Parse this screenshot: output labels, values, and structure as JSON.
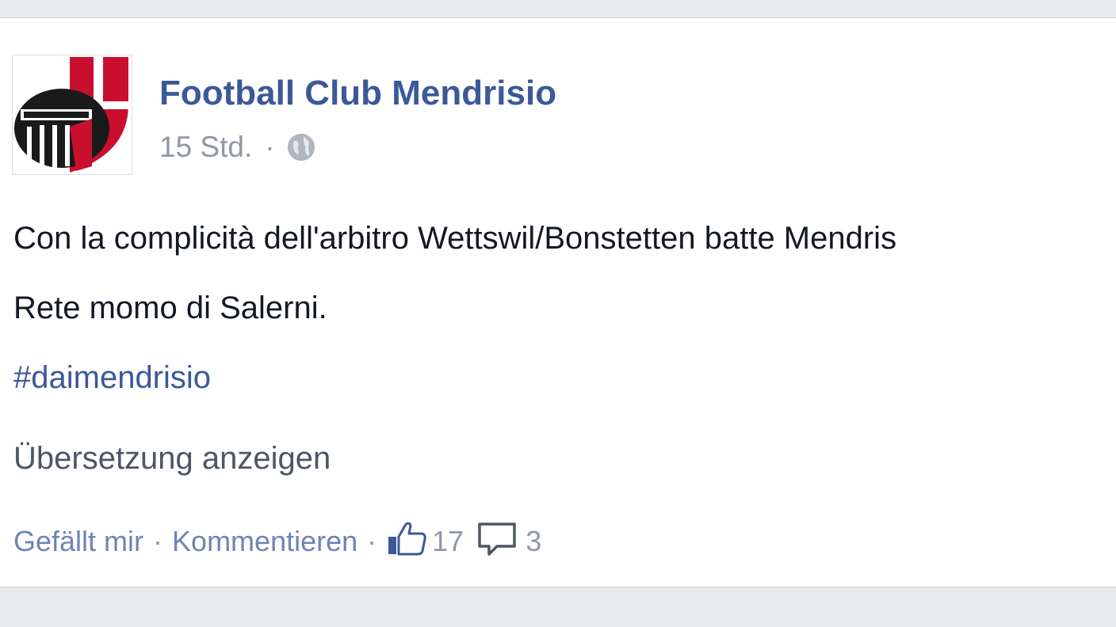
{
  "post": {
    "page_name": "Football Club Mendrisio",
    "time": "15 Std.",
    "meta_separator": "·",
    "audience_icon": "globe-icon",
    "text_line_1": "Con la complicità dell'arbitro Wettswil/Bonstetten batte Mendris",
    "text_line_2": "Rete momo di Salerni.",
    "hashtag": "#daimendrisio",
    "translate_label": "Übersetzung anzeigen"
  },
  "actions": {
    "like_label": "Gefällt mir",
    "comment_label": "Kommentieren",
    "separator": "·",
    "like_icon": "thumbs-up-icon",
    "like_count": "17",
    "comment_icon": "speech-bubble-icon",
    "comment_count": "3"
  },
  "colors": {
    "link_blue": "#3b5998",
    "muted_gray": "#9197a3",
    "logo_red": "#c8102e",
    "logo_black": "#1a1a1a"
  }
}
